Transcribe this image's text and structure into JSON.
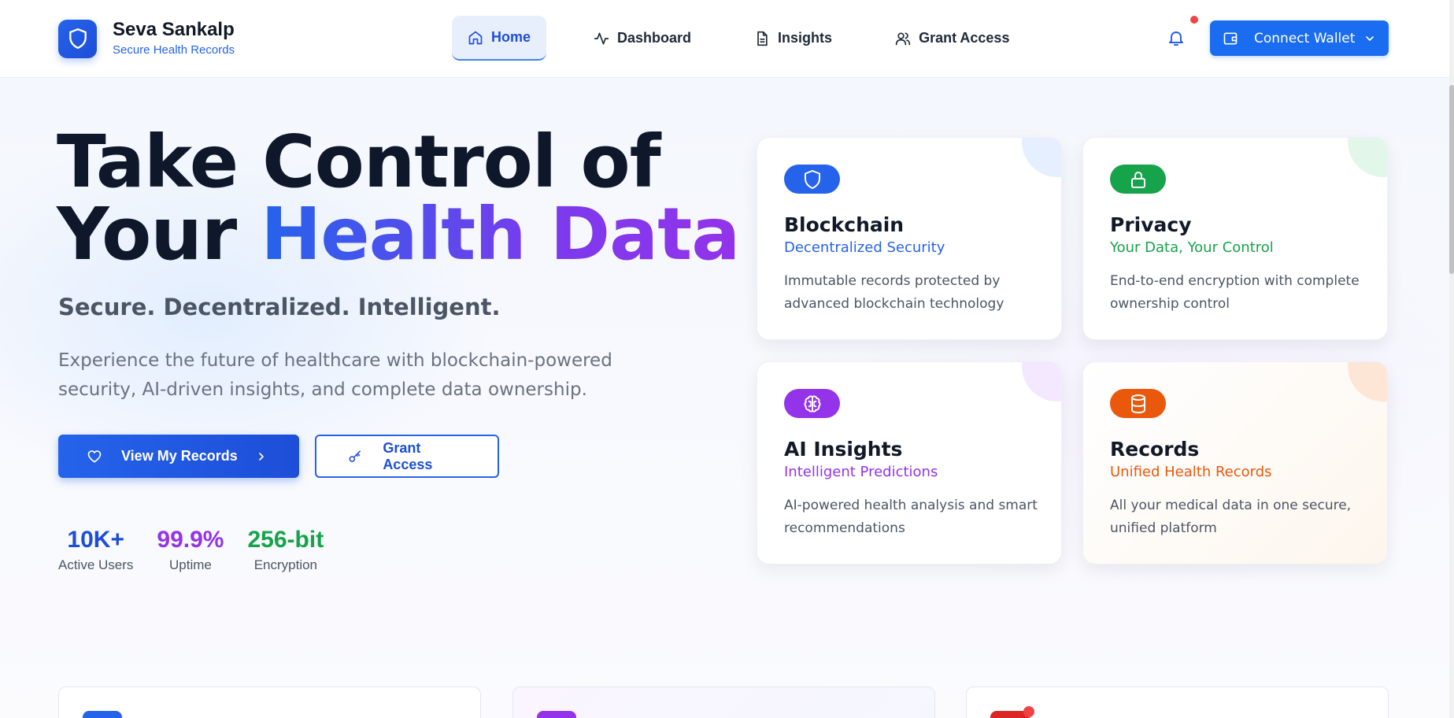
{
  "brand": {
    "name": "Seva Sankalp",
    "tagline": "Secure Health Records"
  },
  "nav": {
    "items": [
      {
        "label": "Home",
        "icon": "home-icon",
        "active": true
      },
      {
        "label": "Dashboard",
        "icon": "activity-icon",
        "active": false
      },
      {
        "label": "Insights",
        "icon": "document-icon",
        "active": false
      },
      {
        "label": "Grant Access",
        "icon": "users-icon",
        "active": false
      }
    ]
  },
  "header": {
    "wallet_label": "Connect Wallet"
  },
  "hero": {
    "title_line1": "Take Control of",
    "title_line2_plain": "Your ",
    "title_line2_highlight": "Health Data",
    "tagline": "Secure. Decentralized. Intelligent.",
    "description": "Experience the future of healthcare with blockchain-powered security, AI-driven insights, and complete data ownership.",
    "primary_button": "View My Records",
    "secondary_button": "Grant Access"
  },
  "stats": [
    {
      "value": "10K+",
      "label": "Active Users",
      "color": "#1d4ed8"
    },
    {
      "value": "99.9%",
      "label": "Uptime",
      "color": "#9333ea"
    },
    {
      "value": "256-bit",
      "label": "Encryption",
      "color": "#16a34a"
    }
  ],
  "features": [
    {
      "title": "Blockchain",
      "subtitle": "Decentralized Security",
      "description": "Immutable records protected by advanced blockchain technology",
      "color": "#2563eb",
      "icon": "shield-icon"
    },
    {
      "title": "Privacy",
      "subtitle": "Your Data, Your Control",
      "description": "End-to-end encryption with complete ownership control",
      "color": "#16a34a",
      "icon": "lock-icon"
    },
    {
      "title": "AI Insights",
      "subtitle": "Intelligent Predictions",
      "description": "AI-powered health analysis and smart recommendations",
      "color": "#9333ea",
      "icon": "brain-icon"
    },
    {
      "title": "Records",
      "subtitle": "Unified Health Records",
      "description": "All your medical data in one secure, unified platform",
      "color": "#ea580c",
      "icon": "database-icon"
    }
  ],
  "colors": {
    "primary": "#1a6cf0",
    "accent_purple": "#9333ea",
    "notification": "#ef4444"
  }
}
